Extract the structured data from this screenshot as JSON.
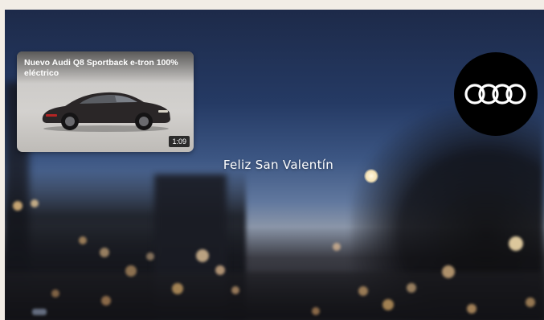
{
  "video": {
    "title": "Nuevo Audi Q8 Sportback e-tron 100% eléctrico",
    "duration": "1:09",
    "thumbnail_icon": "car-icon"
  },
  "brand": {
    "logo_icon": "audi-rings-icon",
    "badge_color": "#000000"
  },
  "message": {
    "text": "Feliz San Valentín"
  }
}
